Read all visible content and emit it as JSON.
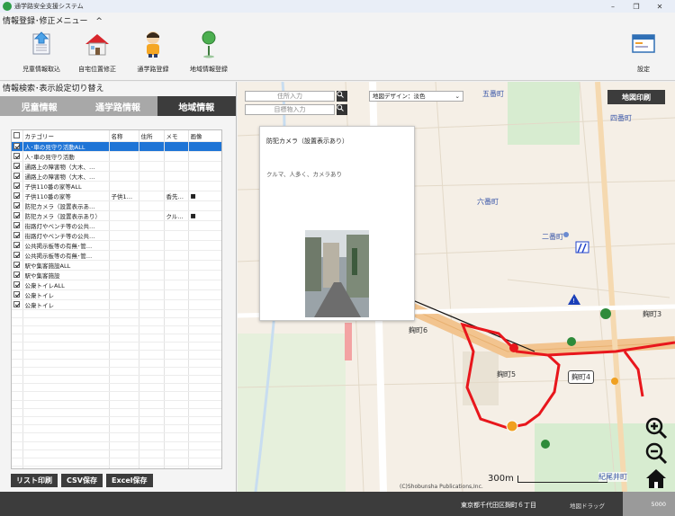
{
  "window": {
    "title": "通学路安全支援システム",
    "controls": [
      "–",
      "❐",
      "✕"
    ]
  },
  "ribbon": {
    "title": "情報登録･修正メニュー",
    "collapse_glyph": "^",
    "buttons": [
      {
        "label": "児童情報取込",
        "icon": "import-icon"
      },
      {
        "label": "自宅位置修正",
        "icon": "house-icon"
      },
      {
        "label": "通学路登録",
        "icon": "student-icon"
      },
      {
        "label": "地域情報登録",
        "icon": "pin-icon"
      },
      {
        "label": "設定",
        "icon": "settings-window-icon"
      }
    ]
  },
  "left": {
    "header": "情報検索･表示設定切り替え",
    "tabs": [
      {
        "label": "児童情報",
        "active": false
      },
      {
        "label": "通学路情報",
        "active": false
      },
      {
        "label": "地域情報",
        "active": true
      }
    ],
    "columns": [
      "カテゴリー",
      "名称",
      "住所",
      "メモ",
      "画像"
    ],
    "rows": [
      {
        "checked": true,
        "category": "人･車の見守り活動ALL",
        "name": "",
        "address": "",
        "memo": "",
        "image": "",
        "selected": true
      },
      {
        "checked": true,
        "category": "人･車の見守り活動",
        "name": "",
        "address": "",
        "memo": "",
        "image": "",
        "selected": false
      },
      {
        "checked": true,
        "category": "通路上の障害物（大木、…",
        "name": "",
        "address": "",
        "memo": "",
        "image": "",
        "selected": false
      },
      {
        "checked": true,
        "category": "通路上の障害物（大木、…",
        "name": "",
        "address": "",
        "memo": "",
        "image": "",
        "selected": false
      },
      {
        "checked": true,
        "category": "子供110番の家等ALL",
        "name": "",
        "address": "",
        "memo": "",
        "image": "",
        "selected": false
      },
      {
        "checked": true,
        "category": "子供110番の家等",
        "name": "子供1…",
        "address": "",
        "memo": "香先…",
        "image": "■",
        "selected": false
      },
      {
        "checked": true,
        "category": "防犯カメラ（設置表示あ…",
        "name": "",
        "address": "",
        "memo": "",
        "image": "",
        "selected": false
      },
      {
        "checked": true,
        "category": "防犯カメラ（設置表示あり）",
        "name": "",
        "address": "",
        "memo": "クル…",
        "image": "■",
        "selected": false
      },
      {
        "checked": true,
        "category": "街路灯やベンチ等の公共…",
        "name": "",
        "address": "",
        "memo": "",
        "image": "",
        "selected": false
      },
      {
        "checked": true,
        "category": "街路灯やベンチ等の公共…",
        "name": "",
        "address": "",
        "memo": "",
        "image": "",
        "selected": false
      },
      {
        "checked": true,
        "category": "公共掲示板等の有無･管…",
        "name": "",
        "address": "",
        "memo": "",
        "image": "",
        "selected": false
      },
      {
        "checked": true,
        "category": "公共掲示板等の有無･管…",
        "name": "",
        "address": "",
        "memo": "",
        "image": "",
        "selected": false
      },
      {
        "checked": true,
        "category": "駅や集客施設ALL",
        "name": "",
        "address": "",
        "memo": "",
        "image": "",
        "selected": false
      },
      {
        "checked": true,
        "category": "駅や集客施設",
        "name": "",
        "address": "",
        "memo": "",
        "image": "",
        "selected": false
      },
      {
        "checked": true,
        "category": "公衆トイレALL",
        "name": "",
        "address": "",
        "memo": "",
        "image": "",
        "selected": false
      },
      {
        "checked": true,
        "category": "公衆トイレ",
        "name": "",
        "address": "",
        "memo": "",
        "image": "",
        "selected": false
      },
      {
        "checked": true,
        "category": "公衆トイレ",
        "name": "",
        "address": "",
        "memo": "",
        "image": "",
        "selected": false
      }
    ],
    "buttons": [
      "リスト印刷",
      "CSV保存",
      "Excel保存"
    ]
  },
  "map": {
    "address_placeholder": "住所入力",
    "landmark_placeholder": "目標物入力",
    "design_select": "地図デザイン：淡色",
    "print_label": "地図印刷",
    "places": [
      {
        "text": "五番町",
        "blue": true
      },
      {
        "text": "四番町",
        "blue": true
      },
      {
        "text": "六番町",
        "blue": true
      },
      {
        "text": "二番町",
        "blue": true
      },
      {
        "text": "麹町3",
        "blue": false
      },
      {
        "text": "麹町6",
        "blue": false
      },
      {
        "text": "麹町5",
        "blue": false
      },
      {
        "text": "麹町4",
        "blue": false
      }
    ],
    "popup": {
      "title": "防犯カメラ（設置表示あり）",
      "text": "クルマ、人多く、カメラあり"
    },
    "copyright": "(C)Shobunsha Publications,Inc.",
    "scale_label": "300m",
    "kioi_label": "紀尾井町",
    "colors": {
      "route": "#e8161c",
      "road": "#f2c48f",
      "park": "#d7ecd0"
    }
  },
  "status": {
    "address": "東京都千代田区麹町６丁目",
    "mode": "地図ドラッグ",
    "scale": "5000"
  }
}
